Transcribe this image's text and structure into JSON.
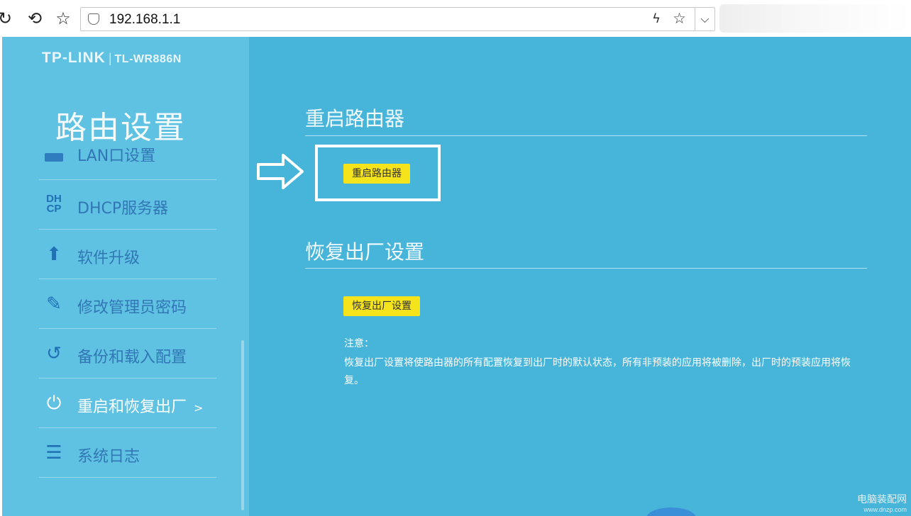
{
  "browser": {
    "reload_glyph": "↻",
    "back_glyph": "⟲",
    "star_glyph": "☆",
    "address": "192.168.1.1",
    "bolt_glyph": "ϟ",
    "chevron_glyph": "⌵"
  },
  "sidebar": {
    "brand_logo": "TP-LINK",
    "brand_sep": "|",
    "brand_model": "TL-WR886N",
    "title": "路由设置",
    "items": [
      {
        "label": "LAN口设置",
        "icon": "lan-icon",
        "cut": true
      },
      {
        "label": "DHCP服务器",
        "icon": "dhcp-icon",
        "icon_text": "DH\nCP"
      },
      {
        "label": "软件升级",
        "icon": "upload-icon",
        "icon_text": "⬆"
      },
      {
        "label": "修改管理员密码",
        "icon": "pencil-icon",
        "icon_text": "✎"
      },
      {
        "label": "备份和载入配置",
        "icon": "history-icon",
        "icon_text": "↺"
      },
      {
        "label": "重启和恢复出厂",
        "icon": "power-icon",
        "icon_text": "⏻",
        "active": true,
        "chevron": ">"
      },
      {
        "label": "系统日志",
        "icon": "list-icon",
        "icon_text": "☰"
      }
    ]
  },
  "main": {
    "reboot": {
      "title": "重启路由器",
      "button": "重启路由器"
    },
    "factory": {
      "title": "恢复出厂设置",
      "button": "恢复出厂设置",
      "note_title": "注意：",
      "note_text": "恢复出厂设置将使路由器的所有配置恢复到出厂时的默认状态，所有非预装的应用将被删除，出厂时的预装应用将恢复。"
    }
  },
  "watermark": {
    "line1": "电脑装配网",
    "line2": "www.dnzp.com"
  },
  "colors": {
    "sidebar_bg": "#5fc2e2",
    "main_bg": "#47b5da",
    "button_yellow": "#f5e31c",
    "nav_text": "#3277b5"
  }
}
